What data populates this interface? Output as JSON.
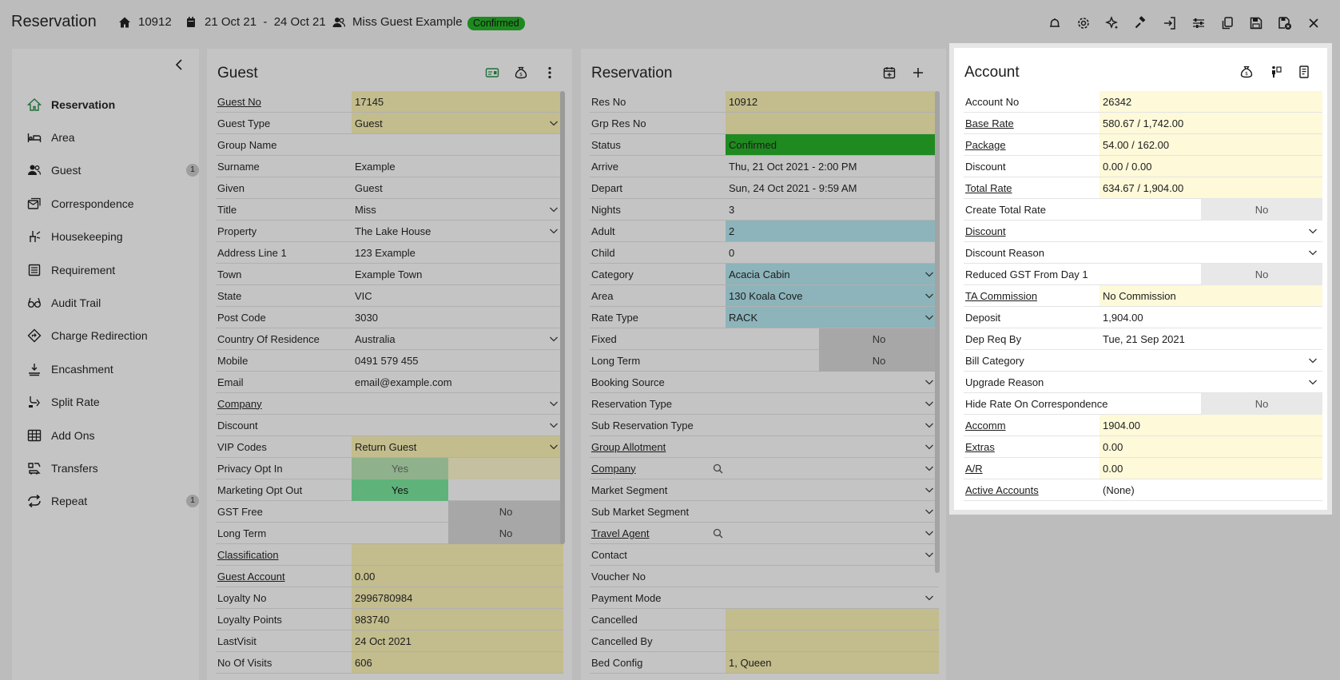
{
  "header": {
    "title": "Reservation",
    "res_no": "10912",
    "dates": "21 Oct 21  -  24 Oct 21",
    "guest_name": "Miss Guest Example",
    "status": "Confirmed"
  },
  "toolbar_icons": [
    "bell-icon",
    "gear-icon",
    "sparkle-icon",
    "gavel-icon",
    "check-in-icon",
    "sliders-icon",
    "copy-icon",
    "save-icon",
    "save-close-icon",
    "close-icon"
  ],
  "sidenav": {
    "items": [
      {
        "label": "Reservation",
        "icon": "home-icon",
        "count": ""
      },
      {
        "label": "Area",
        "icon": "bed-icon",
        "count": ""
      },
      {
        "label": "Guest",
        "icon": "guests-icon",
        "count": "1"
      },
      {
        "label": "Correspondence",
        "icon": "correspondence-icon",
        "count": ""
      },
      {
        "label": "Housekeeping",
        "icon": "housekeeping-icon",
        "count": ""
      },
      {
        "label": "Requirement",
        "icon": "requirement-icon",
        "count": ""
      },
      {
        "label": "Audit Trail",
        "icon": "glasses-icon",
        "count": ""
      },
      {
        "label": "Charge Redirection",
        "icon": "redirect-icon",
        "count": ""
      },
      {
        "label": "Encashment",
        "icon": "encashment-icon",
        "count": ""
      },
      {
        "label": "Split Rate",
        "icon": "split-icon",
        "count": ""
      },
      {
        "label": "Add Ons",
        "icon": "addons-icon",
        "count": ""
      },
      {
        "label": "Transfers",
        "icon": "transfers-icon",
        "count": ""
      },
      {
        "label": "Repeat",
        "icon": "repeat-icon",
        "count": "1"
      }
    ]
  },
  "guest": {
    "title": "Guest",
    "rows": [
      {
        "label": "Guest No",
        "value": "17145"
      },
      {
        "label": "Guest Type",
        "value": "Guest"
      },
      {
        "label": "Group Name",
        "value": ""
      },
      {
        "label": "Surname",
        "value": "Example"
      },
      {
        "label": "Given",
        "value": "Guest"
      },
      {
        "label": "Title",
        "value": "Miss"
      },
      {
        "label": "Property",
        "value": "The Lake House"
      },
      {
        "label": "Address Line 1",
        "value": "123 Example"
      },
      {
        "label": "Town",
        "value": "Example Town"
      },
      {
        "label": "State",
        "value": "VIC"
      },
      {
        "label": "Post Code",
        "value": "3030"
      },
      {
        "label": "Country Of Residence",
        "value": "Australia"
      },
      {
        "label": "Mobile",
        "value": "0491 579 455"
      },
      {
        "label": "Email",
        "value": "email@example.com"
      },
      {
        "label": "Company",
        "value": ""
      },
      {
        "label": "Discount",
        "value": ""
      },
      {
        "label": "VIP Codes",
        "value": "Return Guest"
      },
      {
        "label": "Privacy Opt In",
        "value": "Yes"
      },
      {
        "label": "Marketing Opt Out",
        "value": "Yes"
      },
      {
        "label": "GST Free",
        "value": "No"
      },
      {
        "label": "Long Term",
        "value": "No"
      },
      {
        "label": "Classification",
        "value": ""
      },
      {
        "label": "Guest Account",
        "value": "0.00"
      },
      {
        "label": "Loyalty No",
        "value": "2996780984"
      },
      {
        "label": "Loyalty Points",
        "value": "983740"
      },
      {
        "label": "LastVisit",
        "value": "24 Oct 2021"
      },
      {
        "label": "No Of Visits",
        "value": "606"
      }
    ]
  },
  "reservation": {
    "title": "Reservation",
    "rows": [
      {
        "label": "Res No",
        "value": "10912"
      },
      {
        "label": "Grp Res No",
        "value": ""
      },
      {
        "label": "Status",
        "value": "Confirmed"
      },
      {
        "label": "Arrive",
        "value": "Thu, 21 Oct 2021 - 2:00 PM"
      },
      {
        "label": "Depart",
        "value": "Sun, 24 Oct 2021 - 9:59 AM"
      },
      {
        "label": "Nights",
        "value": "3"
      },
      {
        "label": "Adult",
        "value": "2"
      },
      {
        "label": "Child",
        "value": "0"
      },
      {
        "label": "Category",
        "value": "Acacia Cabin"
      },
      {
        "label": "Area",
        "value": "130 Koala Cove"
      },
      {
        "label": "Rate Type",
        "value": "RACK"
      },
      {
        "label": "Fixed",
        "value": "No"
      },
      {
        "label": "Long Term",
        "value": "No"
      },
      {
        "label": "Booking Source",
        "value": ""
      },
      {
        "label": "Reservation Type",
        "value": ""
      },
      {
        "label": "Sub Reservation Type",
        "value": ""
      },
      {
        "label": "Group Allotment",
        "value": ""
      },
      {
        "label": "Company",
        "value": ""
      },
      {
        "label": "Market Segment",
        "value": ""
      },
      {
        "label": "Sub Market Segment",
        "value": ""
      },
      {
        "label": "Travel Agent",
        "value": ""
      },
      {
        "label": "Contact",
        "value": ""
      },
      {
        "label": "Voucher No",
        "value": ""
      },
      {
        "label": "Payment Mode",
        "value": ""
      },
      {
        "label": "Cancelled",
        "value": ""
      },
      {
        "label": "Cancelled By",
        "value": ""
      },
      {
        "label": "Bed Config",
        "value": "1, Queen"
      }
    ]
  },
  "account": {
    "title": "Account",
    "rows": [
      {
        "label": "Account No",
        "value": "26342"
      },
      {
        "label": "Base Rate",
        "value": "580.67 / 1,742.00"
      },
      {
        "label": "Package",
        "value": "54.00 / 162.00"
      },
      {
        "label": "Discount",
        "value": "0.00 / 0.00"
      },
      {
        "label": "Total Rate",
        "value": "634.67 / 1,904.00"
      },
      {
        "label": "Create Total Rate",
        "value": "No"
      },
      {
        "label": "Discount",
        "value": ""
      },
      {
        "label": "Discount Reason",
        "value": ""
      },
      {
        "label": "Reduced GST From Day 1",
        "value": "No"
      },
      {
        "label": "TA Commission",
        "value": "No Commission"
      },
      {
        "label": "Deposit",
        "value": "1,904.00"
      },
      {
        "label": "Dep Req By",
        "value": "Tue, 21 Sep 2021"
      },
      {
        "label": "Bill Category",
        "value": ""
      },
      {
        "label": "Upgrade Reason",
        "value": ""
      },
      {
        "label": "Hide Rate On Correspondence",
        "value": "No"
      },
      {
        "label": "Accomm",
        "value": "1904.00"
      },
      {
        "label": "Extras",
        "value": "0.00"
      },
      {
        "label": "A/R",
        "value": "0.00"
      },
      {
        "label": "Active Accounts",
        "value": "(None)"
      }
    ]
  },
  "colors": {
    "confirmed": "#1d8a1f",
    "field_yellow": "#c3bc8d",
    "field_teal": "#8cb4ba",
    "yes_green": "#5fb37a",
    "account_yellow": "#fdf9d9"
  }
}
